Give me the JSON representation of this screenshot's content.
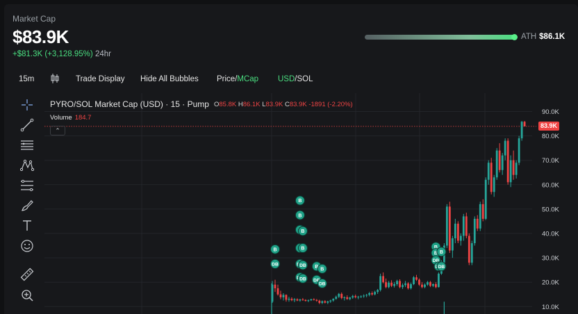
{
  "header": {
    "label": "Market Cap",
    "value": "$83.9K",
    "change_abs": "+$81.3K",
    "change_pct": "(+3,128.95%)",
    "period": "24hr",
    "ath_label": "ATH",
    "ath_value": "$86.1K"
  },
  "toolbar": {
    "interval": "15m",
    "trade_display": "Trade Display",
    "hide_bubbles": "Hide All Bubbles",
    "price_label": "Price",
    "mcap_label": "MCap",
    "usd_label": "USD",
    "sol_label": "SOL",
    "slash": "/"
  },
  "tools": [
    {
      "name": "crosshair-icon"
    },
    {
      "name": "trend-line-icon"
    },
    {
      "name": "horizontal-lines-icon"
    },
    {
      "name": "pattern-icon"
    },
    {
      "name": "measure-lines-icon"
    },
    {
      "name": "brush-icon"
    },
    {
      "name": "text-icon"
    },
    {
      "name": "emoji-icon"
    },
    {
      "name": "ruler-icon"
    },
    {
      "name": "zoom-in-icon"
    }
  ],
  "chart": {
    "title": "PYRO/SOL Market Cap (USD) · 15 · Pump",
    "o_label": "O",
    "o": "85.8K",
    "h_label": "H",
    "h": "86.1K",
    "l_label": "L",
    "l": "83.9K",
    "c_label": "C",
    "c": "83.9K",
    "change": "-1891",
    "change_pct": "(-2.20%)",
    "volume_label": "Volume",
    "volume": "184.7",
    "last_price_tag": "83.9K",
    "collapse_glyph": "⌃"
  },
  "chart_data": {
    "type": "candlestick",
    "y_ticks": [
      "90.0K",
      "80.0K",
      "70.0K",
      "60.0K",
      "50.0K",
      "40.0K",
      "30.0K",
      "20.0K",
      "10.0K"
    ],
    "ylim": [
      7,
      92
    ],
    "last_price": 83.9,
    "colors": {
      "up": "#26a69a",
      "down": "#ef4444",
      "bubble": "#1fa187"
    },
    "candles": [
      [
        12.0,
        20.5,
        11.5,
        19.0
      ],
      [
        19.0,
        21.0,
        16.0,
        17.5
      ],
      [
        17.5,
        19.0,
        14.5,
        15.0
      ],
      [
        15.0,
        16.5,
        13.0,
        13.8
      ],
      [
        13.8,
        15.5,
        12.5,
        14.8
      ],
      [
        14.8,
        15.0,
        12.0,
        12.8
      ],
      [
        12.8,
        14.0,
        12.0,
        13.2
      ],
      [
        13.2,
        13.8,
        12.2,
        12.6
      ],
      [
        12.6,
        13.5,
        11.8,
        13.0
      ],
      [
        13.0,
        13.4,
        12.2,
        12.5
      ],
      [
        12.5,
        13.2,
        12.0,
        12.9
      ],
      [
        12.9,
        13.5,
        12.4,
        12.7
      ],
      [
        12.7,
        13.0,
        12.1,
        12.3
      ],
      [
        12.3,
        12.9,
        11.8,
        12.6
      ],
      [
        12.6,
        13.2,
        12.3,
        13.0
      ],
      [
        13.0,
        13.4,
        12.5,
        12.7
      ],
      [
        12.7,
        13.1,
        12.0,
        12.4
      ],
      [
        12.4,
        12.8,
        11.0,
        11.5
      ],
      [
        11.5,
        12.5,
        11.0,
        12.2
      ],
      [
        12.2,
        12.6,
        11.3,
        11.6
      ],
      [
        11.6,
        12.4,
        11.0,
        12.1
      ],
      [
        12.1,
        12.8,
        11.5,
        12.5
      ],
      [
        12.5,
        13.4,
        12.0,
        13.2
      ],
      [
        13.2,
        14.5,
        12.8,
        14.0
      ],
      [
        14.0,
        15.6,
        13.5,
        15.2
      ],
      [
        15.2,
        15.8,
        13.0,
        13.5
      ],
      [
        13.5,
        14.2,
        12.5,
        13.8
      ],
      [
        13.8,
        14.6,
        12.8,
        13.1
      ],
      [
        13.1,
        14.0,
        12.6,
        13.7
      ],
      [
        13.7,
        14.8,
        13.2,
        14.3
      ],
      [
        14.3,
        14.9,
        13.4,
        13.8
      ],
      [
        13.8,
        14.4,
        13.0,
        14.0
      ],
      [
        14.0,
        14.6,
        13.5,
        14.2
      ],
      [
        14.2,
        15.0,
        13.6,
        14.5
      ],
      [
        14.5,
        15.2,
        13.8,
        14.8
      ],
      [
        14.8,
        16.0,
        14.2,
        15.5
      ],
      [
        15.5,
        16.2,
        14.5,
        15.0
      ],
      [
        15.0,
        16.5,
        14.6,
        16.0
      ],
      [
        16.0,
        17.2,
        15.2,
        16.8
      ],
      [
        16.8,
        23.5,
        16.2,
        22.5
      ],
      [
        22.5,
        24.0,
        19.5,
        20.0
      ],
      [
        20.0,
        21.5,
        17.5,
        18.0
      ],
      [
        18.0,
        20.5,
        17.5,
        19.8
      ],
      [
        19.8,
        20.8,
        18.0,
        18.5
      ],
      [
        18.5,
        20.0,
        17.8,
        19.2
      ],
      [
        19.2,
        21.0,
        18.5,
        20.5
      ],
      [
        20.5,
        21.2,
        17.5,
        18.0
      ],
      [
        18.0,
        19.5,
        17.2,
        18.8
      ],
      [
        18.8,
        20.5,
        18.0,
        19.5
      ],
      [
        19.5,
        20.0,
        17.0,
        17.5
      ],
      [
        17.5,
        19.8,
        17.0,
        19.2
      ],
      [
        19.2,
        22.5,
        18.8,
        22.0
      ],
      [
        22.0,
        23.0,
        20.5,
        21.0
      ],
      [
        21.0,
        21.5,
        18.5,
        19.0
      ],
      [
        19.0,
        20.0,
        17.5,
        18.0
      ],
      [
        18.0,
        19.5,
        17.5,
        19.0
      ],
      [
        19.0,
        20.5,
        18.5,
        20.0
      ],
      [
        20.0,
        20.5,
        18.0,
        18.5
      ],
      [
        18.5,
        19.5,
        18.0,
        19.2
      ],
      [
        19.2,
        20.0,
        17.5,
        18.0
      ],
      [
        18.0,
        24.0,
        17.8,
        23.5
      ],
      [
        23.5,
        29.0,
        23.0,
        28.0
      ],
      [
        28.0,
        36.0,
        27.5,
        35.0
      ],
      [
        35.0,
        52.0,
        34.0,
        51.0
      ],
      [
        51.0,
        53.0,
        32.0,
        33.0
      ],
      [
        33.0,
        39.0,
        30.0,
        38.0
      ],
      [
        38.0,
        46.0,
        36.0,
        44.0
      ],
      [
        44.0,
        45.0,
        36.0,
        37.0
      ],
      [
        37.0,
        40.0,
        35.0,
        39.0
      ],
      [
        39.0,
        48.0,
        37.0,
        47.0
      ],
      [
        47.0,
        48.5,
        38.0,
        39.0
      ],
      [
        39.0,
        40.0,
        27.0,
        28.0
      ],
      [
        28.0,
        37.0,
        27.0,
        36.0
      ],
      [
        36.0,
        47.0,
        35.0,
        46.0
      ],
      [
        46.0,
        47.5,
        41.0,
        42.0
      ],
      [
        42.0,
        53.0,
        41.0,
        52.0
      ],
      [
        52.0,
        54.0,
        45.0,
        46.0
      ],
      [
        46.0,
        63.0,
        45.5,
        62.0
      ],
      [
        62.0,
        70.0,
        60.0,
        69.0
      ],
      [
        69.0,
        71.0,
        56.0,
        57.0
      ],
      [
        57.0,
        64.0,
        55.0,
        63.0
      ],
      [
        63.0,
        75.0,
        62.0,
        74.0
      ],
      [
        74.0,
        77.0,
        65.0,
        66.0
      ],
      [
        66.0,
        73.0,
        64.0,
        72.0
      ],
      [
        72.0,
        79.0,
        70.0,
        78.0
      ],
      [
        78.0,
        79.0,
        60.0,
        61.0
      ],
      [
        61.0,
        72.0,
        59.0,
        70.0
      ],
      [
        70.0,
        74.0,
        62.0,
        64.0
      ],
      [
        64.0,
        70.0,
        62.5,
        69.0
      ],
      [
        69.0,
        80.0,
        68.0,
        79.0
      ],
      [
        79.0,
        86.1,
        78.0,
        85.8
      ],
      [
        85.8,
        86.1,
        83.9,
        83.9
      ]
    ],
    "bubbles": [
      {
        "label": "B",
        "i": 1,
        "y": 33.5
      },
      {
        "label": "DB",
        "i": 1,
        "y": 27.5
      },
      {
        "label": "B",
        "i": 10,
        "y": 53.5
      },
      {
        "label": "B",
        "i": 10,
        "y": 47.5
      },
      {
        "label": "B",
        "i": 10,
        "y": 41.5
      },
      {
        "label": "B",
        "i": 11,
        "y": 41.0
      },
      {
        "label": "B",
        "i": 10,
        "y": 34.0
      },
      {
        "label": "B",
        "i": 11,
        "y": 34.0
      },
      {
        "label": "DB",
        "i": 10,
        "y": 27.5
      },
      {
        "label": "DB",
        "i": 11,
        "y": 27.0
      },
      {
        "label": "DB",
        "i": 10,
        "y": 22.0
      },
      {
        "label": "DB",
        "i": 11,
        "y": 21.5
      },
      {
        "label": "B",
        "i": 16,
        "y": 26.5
      },
      {
        "label": "B",
        "i": 18,
        "y": 25.5
      },
      {
        "label": "DB",
        "i": 16,
        "y": 21.0
      },
      {
        "label": "DB",
        "i": 18,
        "y": 19.5
      },
      {
        "label": "B",
        "i": 59,
        "y": 34.5
      },
      {
        "label": "B",
        "i": 59,
        "y": 32.0
      },
      {
        "label": "B",
        "i": 61,
        "y": 32.5
      },
      {
        "label": "DB",
        "i": 59,
        "y": 29.0
      },
      {
        "label": "DB",
        "i": 60,
        "y": 26.5
      },
      {
        "label": "DB",
        "i": 61,
        "y": 26.5
      }
    ]
  }
}
